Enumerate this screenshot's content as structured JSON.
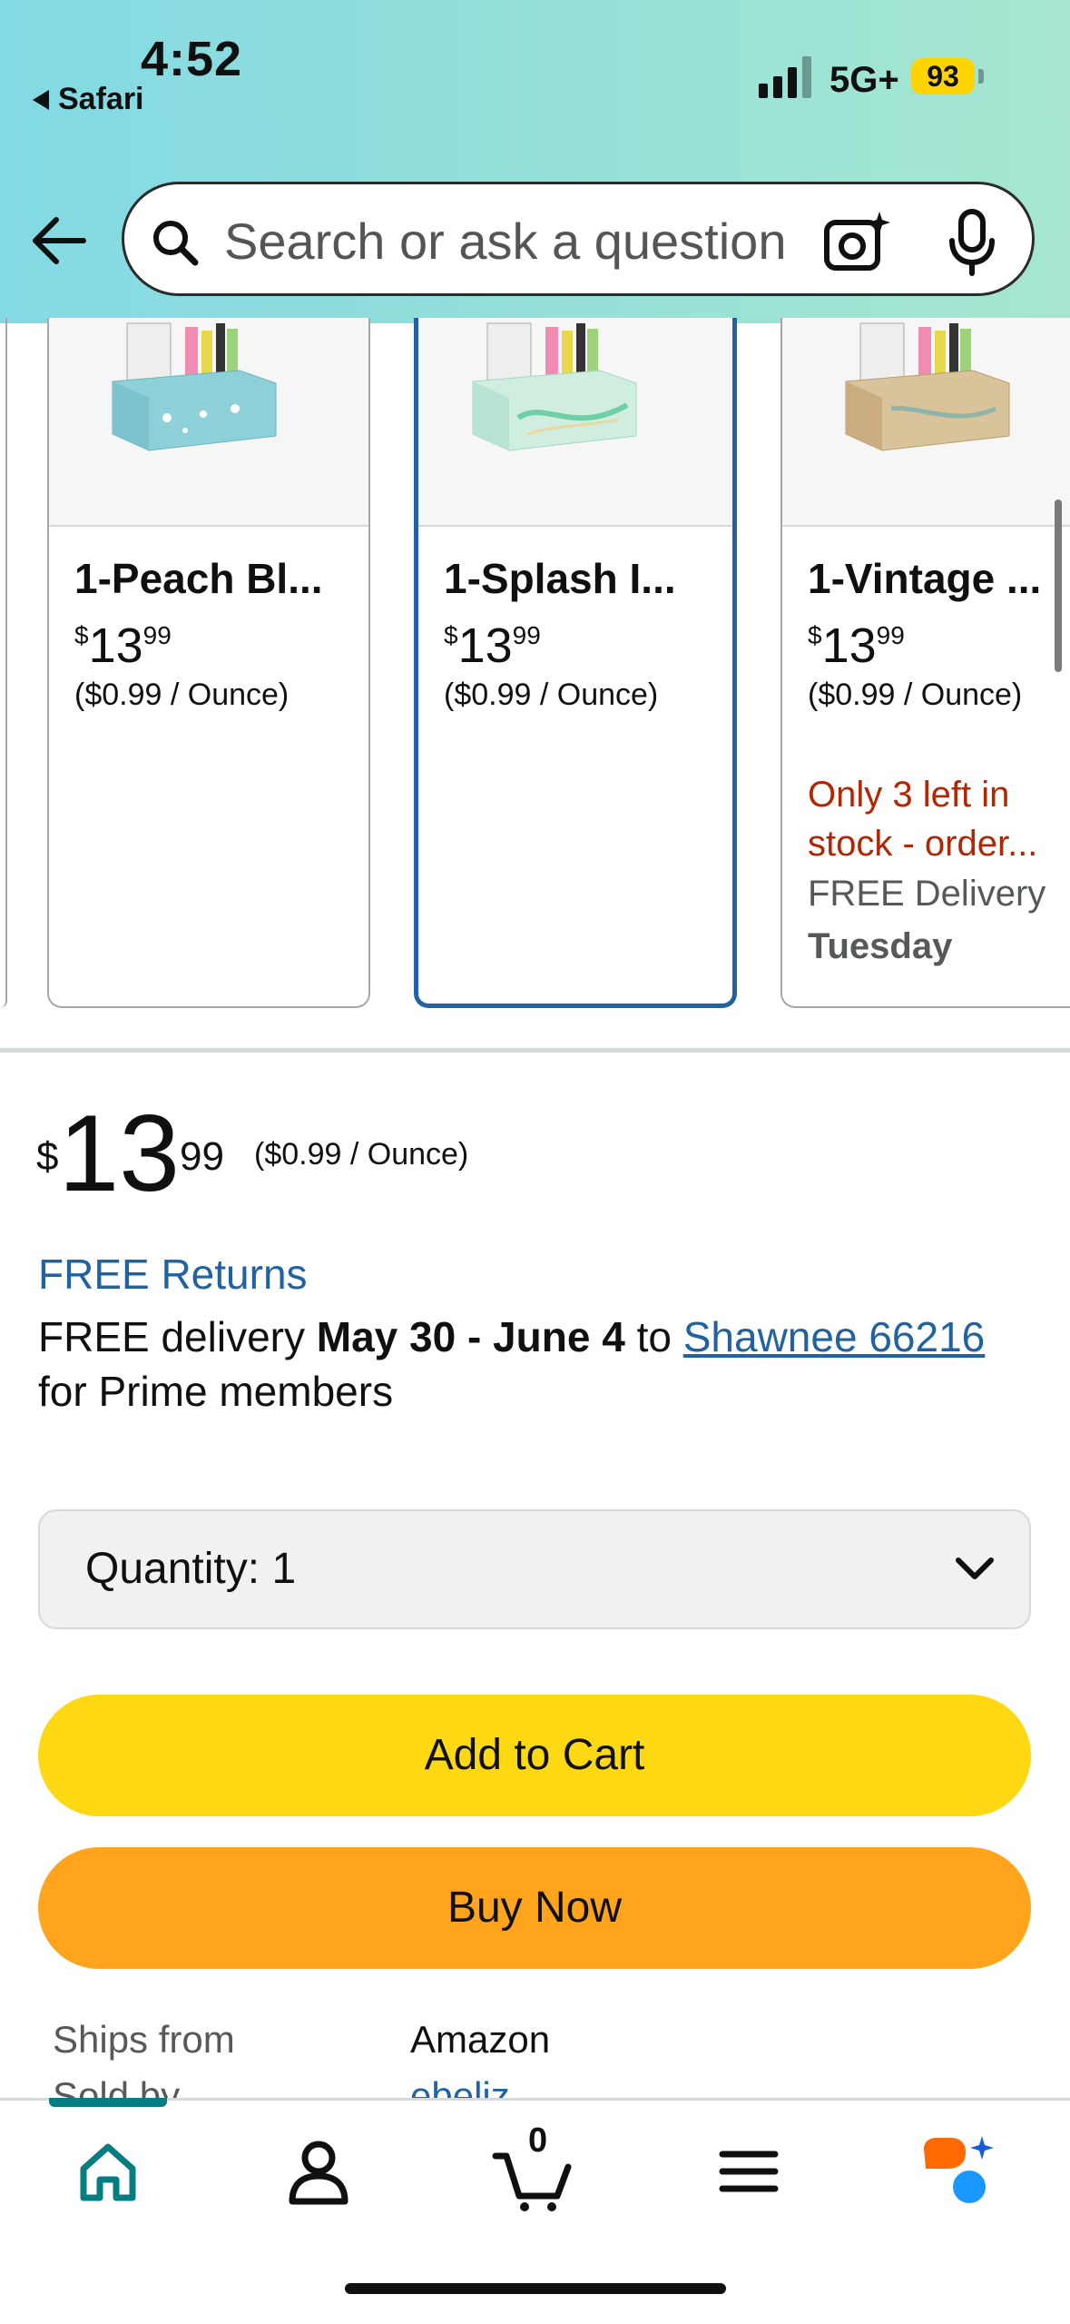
{
  "status_bar": {
    "time": "4:52",
    "back_app": "Safari",
    "network": "5G+",
    "battery": "93"
  },
  "search": {
    "placeholder": "Search or ask a question",
    "icons": [
      "back-arrow-icon",
      "search-icon",
      "camera-ai-icon",
      "microphone-icon"
    ]
  },
  "variants": [
    {
      "title": "1-Peach Bl...",
      "price_currency": "$",
      "price_dollars": "13",
      "price_cents": "99",
      "unit_price": "($0.99 / Ounce)",
      "stock": "",
      "delivery": "",
      "delivery_day": ""
    },
    {
      "title": "1-Splash I...",
      "price_currency": "$",
      "price_dollars": "13",
      "price_cents": "99",
      "unit_price": "($0.99 / Ounce)",
      "stock": "",
      "delivery": "",
      "delivery_day": "",
      "selected": true
    },
    {
      "title": "1-Vintage ...",
      "price_currency": "$",
      "price_dollars": "13",
      "price_cents": "99",
      "unit_price": "($0.99 / Ounce)",
      "stock": "Only 3 left in stock - order...",
      "delivery": "FREE Delivery",
      "delivery_day": "Tuesday"
    }
  ],
  "product": {
    "price_currency": "$",
    "price_dollars": "13",
    "price_cents": "99",
    "unit_price": "($0.99 / Ounce)",
    "free_returns": "FREE Returns",
    "delivery_prefix": "FREE delivery ",
    "delivery_dates": "May 30 - June 4",
    "delivery_to": " to ",
    "delivery_location": "Shawnee 66216",
    "delivery_suffix": "for Prime members",
    "quantity_label": "Quantity:",
    "quantity_value": "1",
    "add_to_cart": "Add to Cart",
    "buy_now": "Buy Now",
    "ships_from_label": "Ships from",
    "ships_from_value": "Amazon",
    "sold_by_label": "Sold by",
    "sold_by_value": "ebeliz"
  },
  "tab_bar": {
    "cart_count": "0",
    "tabs": [
      "home-icon",
      "account-icon",
      "cart-icon",
      "menu-icon",
      "rufus-ai-icon"
    ]
  },
  "colors": {
    "link": "#2162a1",
    "stock_warning": "#b12704",
    "add_to_cart": "#ffd814",
    "buy_now": "#ffa41c",
    "selected_border": "#2162a1",
    "active_tab": "#067d81"
  }
}
